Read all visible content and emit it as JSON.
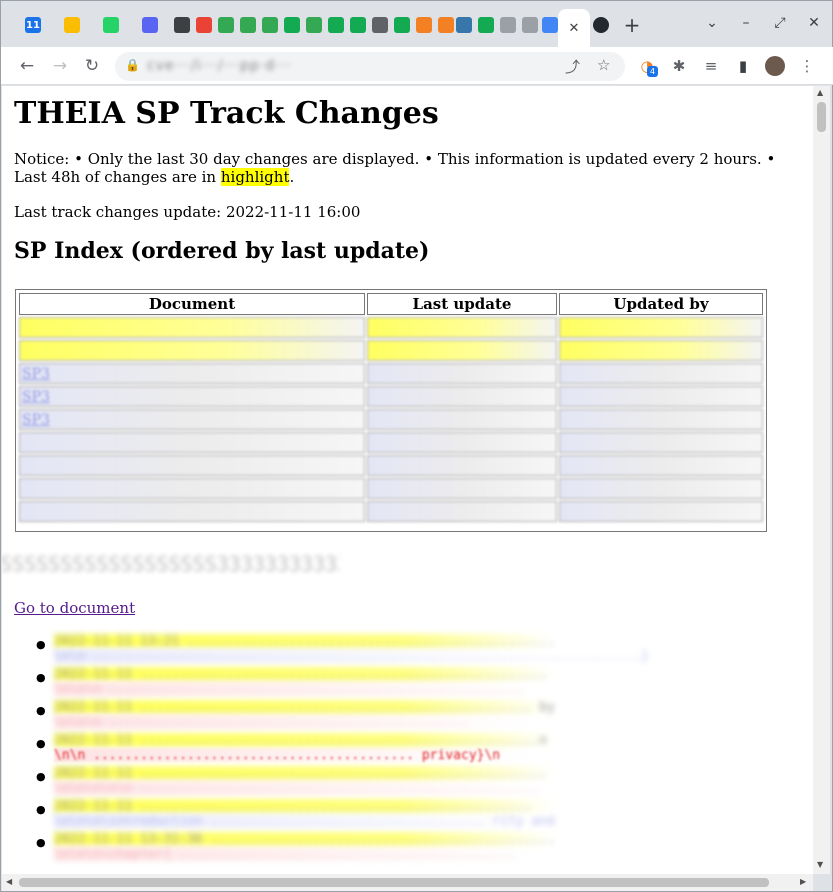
{
  "browser": {
    "tabs": [
      {
        "icon": "calendar-icon",
        "label": "11",
        "color": "#1a73e8"
      },
      {
        "icon": "bulb-icon",
        "label": "",
        "color": "#fbbc04"
      },
      {
        "icon": "whatsapp-icon",
        "label": "",
        "color": "#25d366"
      },
      {
        "icon": "discord-icon",
        "label": "",
        "color": "#5865f2"
      },
      {
        "icon": "speaker-icon",
        "label": "",
        "color": "#3c4043"
      },
      {
        "icon": "gmail-icon",
        "label": "",
        "color": "#ea4335"
      },
      {
        "icon": "leaf-icon",
        "label": "",
        "color": "#34a853"
      },
      {
        "icon": "leaf-icon",
        "label": "",
        "color": "#34a853"
      },
      {
        "icon": "leaf-icon",
        "label": "",
        "color": "#34a853"
      },
      {
        "icon": "mongo-icon",
        "label": "",
        "color": "#13aa52"
      },
      {
        "icon": "leaf-icon",
        "label": "",
        "color": "#34a853"
      },
      {
        "icon": "mongo-icon",
        "label": "",
        "color": "#13aa52"
      },
      {
        "icon": "mongo-icon",
        "label": "",
        "color": "#13aa52"
      },
      {
        "icon": "grid-icon",
        "label": "",
        "color": "#5f6368"
      },
      {
        "icon": "mongo-icon",
        "label": "",
        "color": "#13aa52"
      },
      {
        "icon": "stackoverflow-icon",
        "label": "",
        "color": "#f48024"
      },
      {
        "icon": "stackoverflow-icon",
        "label": "",
        "color": "#f48024"
      },
      {
        "icon": "python-icon",
        "label": "",
        "color": "#3776ab"
      },
      {
        "icon": "mongo-icon",
        "label": "",
        "color": "#13aa52"
      },
      {
        "icon": "docker-icon",
        "label": "",
        "color": "#9aa0a6"
      },
      {
        "icon": "chart-icon",
        "label": "",
        "color": "#9aa0a6"
      },
      {
        "icon": "globe-icon",
        "label": "",
        "color": "#4285f4"
      }
    ],
    "active_tab_close": "✕",
    "new_tab": "+",
    "url_blurred": "cve···/i···/···pp·d···"
  },
  "page": {
    "title": "THEIA SP Track Changes",
    "notice_prefix": "Notice: • Only the last 30 day changes are displayed. • This information is updated every 2 hours. • Last 48h of changes are in ",
    "notice_highlight": "highlight",
    "notice_suffix": ".",
    "last_update_label": "Last track changes update: 2022-11-11 16:00",
    "index_heading": "SP Index (ordered by last update)",
    "index_table": {
      "headers": [
        "Document",
        "Last update",
        "Updated by"
      ],
      "rows": [
        {
          "doc": "",
          "style": "yellow"
        },
        {
          "doc": "",
          "style": "yellow"
        },
        {
          "doc": "SP3",
          "style": "link"
        },
        {
          "doc": "SP3",
          "style": "link"
        },
        {
          "doc": "SP3",
          "style": "link"
        },
        {
          "doc": "",
          "style": "plain"
        },
        {
          "doc": "",
          "style": "plain"
        },
        {
          "doc": "",
          "style": "plain"
        },
        {
          "doc": "",
          "style": "plain"
        }
      ]
    },
    "blurred_doc_heading": "SSSSSSSSSSSSSSSSSS33333333333333311111",
    "go_to_document": "Go to document",
    "changes": [
      {
        "line1": "2022-11-11 13:21 ...............................................",
        "line2": "\\n\\n ......................................................................}"
      },
      {
        "line1": "2022-11-11 ....................................................",
        "line2": "\\n\\n\\n ....................................................."
      },
      {
        "line1": "2022-11-11 .................................................. by unknown",
        "line2": "\\n\\n\\n .............................................."
      },
      {
        "line1": "2022-11-11 ...................................................n",
        "line2": "\\n\\n ......................................... privacy}\\n"
      },
      {
        "line1": "2022-11-11 ....................................................",
        "line2": "\\n\\n\\n\\n\\n ..................................................."
      },
      {
        "line1": "2022-11-11 ..................................................",
        "line2": "\\n\\n\\n\\introduction ................................... rity and"
      },
      {
        "line1": "2022-11-11 13:31:36 ............................................",
        "line2": "\\n\\n\\n\\chapter{ ..........................................."
      }
    ]
  }
}
